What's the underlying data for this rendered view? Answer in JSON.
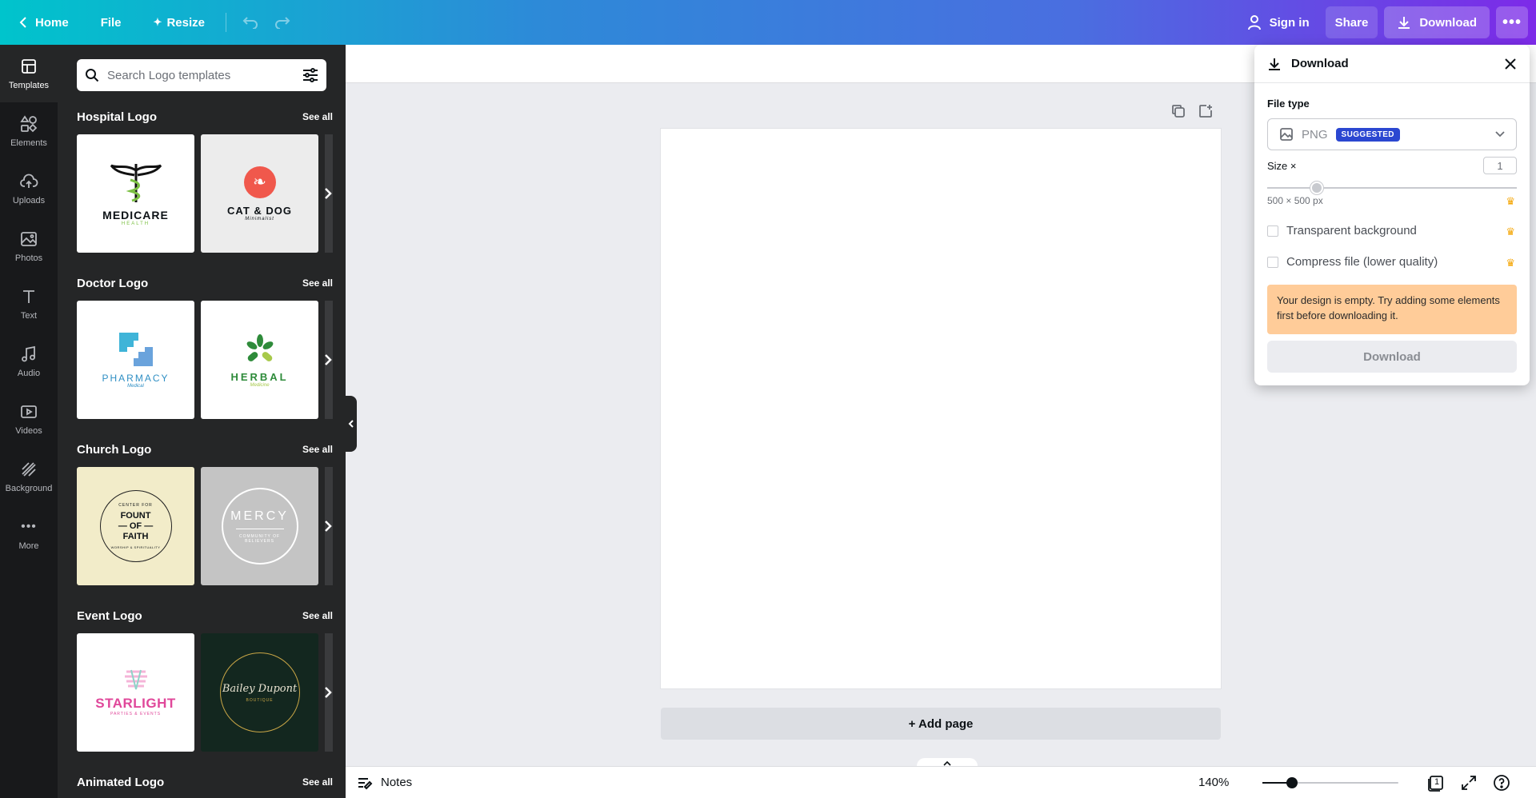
{
  "topbar": {
    "home": "Home",
    "file": "File",
    "resize": "Resize",
    "sign_in": "Sign in",
    "share": "Share",
    "download": "Download"
  },
  "rail": [
    {
      "label": "Templates",
      "icon": "templates-icon"
    },
    {
      "label": "Elements",
      "icon": "elements-icon"
    },
    {
      "label": "Uploads",
      "icon": "uploads-icon"
    },
    {
      "label": "Photos",
      "icon": "photos-icon"
    },
    {
      "label": "Text",
      "icon": "text-icon"
    },
    {
      "label": "Audio",
      "icon": "audio-icon"
    },
    {
      "label": "Videos",
      "icon": "videos-icon"
    },
    {
      "label": "Background",
      "icon": "background-icon"
    },
    {
      "label": "More",
      "icon": "more-icon"
    }
  ],
  "search": {
    "placeholder": "Search Logo templates"
  },
  "sections": [
    {
      "title": "Hospital Logo",
      "see_all": "See all",
      "t1": {
        "main": "MEDICARE",
        "sub": "HEALTH"
      },
      "t2": {
        "main": "CAT & DOG",
        "sub": "Minimalist"
      }
    },
    {
      "title": "Doctor Logo",
      "see_all": "See all",
      "t1": {
        "main": "PHARMACY",
        "sub": "Medical"
      },
      "t2": {
        "main": "HERBAL",
        "sub": "Medicine"
      }
    },
    {
      "title": "Church Logo",
      "see_all": "See all",
      "t1": {
        "main": "FOUNT\n— OF —\nFAITH",
        "top": "CENTER FOR",
        "bottom": "WORSHIP & SPIRITUALITY"
      },
      "t2": {
        "main": "MERCY",
        "sub": "COMMUNITY OF BELIEVERS"
      }
    },
    {
      "title": "Event Logo",
      "see_all": "See all",
      "t1": {
        "main": "STARLIGHT",
        "sub": "PARTIES & EVENTS"
      },
      "t2": {
        "main": "Bailey Dupont",
        "sub": "BOUTIQUE"
      }
    },
    {
      "title": "Animated Logo",
      "see_all": "See all"
    }
  ],
  "canvas": {
    "add_page": "+ Add page"
  },
  "footer": {
    "notes": "Notes",
    "zoom": "140%",
    "zoom_fraction": 0.22,
    "page_count": "1"
  },
  "download_panel": {
    "title": "Download",
    "file_type_label": "File type",
    "file_type_value": "PNG",
    "suggested_badge": "SUGGESTED",
    "size_label": "Size ×",
    "size_value": "1",
    "dimensions": "500 × 500 px",
    "transparent_bg": "Transparent background",
    "compress": "Compress file (lower quality)",
    "warning": "Your design is empty. Try adding some elements first before downloading it.",
    "download_button": "Download"
  }
}
